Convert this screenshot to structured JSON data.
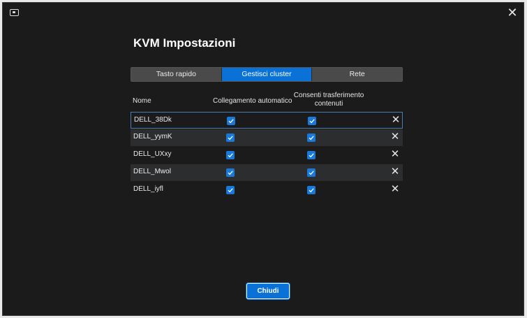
{
  "window": {
    "icon": "monitor-icon",
    "close_icon": "close-icon"
  },
  "title": "KVM Impostazioni",
  "tabs": [
    {
      "label": "Tasto rapido",
      "active": false
    },
    {
      "label": "Gestisci cluster",
      "active": true
    },
    {
      "label": "Rete",
      "active": false
    }
  ],
  "table": {
    "headers": {
      "name": "Nome",
      "auto_connect": "Collegamento automatico",
      "allow_transfer": "Consenti trasferimento contenuti"
    },
    "rows": [
      {
        "name": "DELL_38Dk",
        "auto_connect": true,
        "allow_transfer": true
      },
      {
        "name": "DELL_yymK",
        "auto_connect": true,
        "allow_transfer": true
      },
      {
        "name": "DELL_UXxy",
        "auto_connect": true,
        "allow_transfer": true
      },
      {
        "name": "DELL_Mwol",
        "auto_connect": true,
        "allow_transfer": true
      },
      {
        "name": "DELL_iyfl",
        "auto_connect": true,
        "allow_transfer": true
      }
    ]
  },
  "close_button": "Chiudi",
  "colors": {
    "accent": "#0a72d6",
    "background": "#1b1b1c",
    "row_alt": "#2b2d2f"
  }
}
